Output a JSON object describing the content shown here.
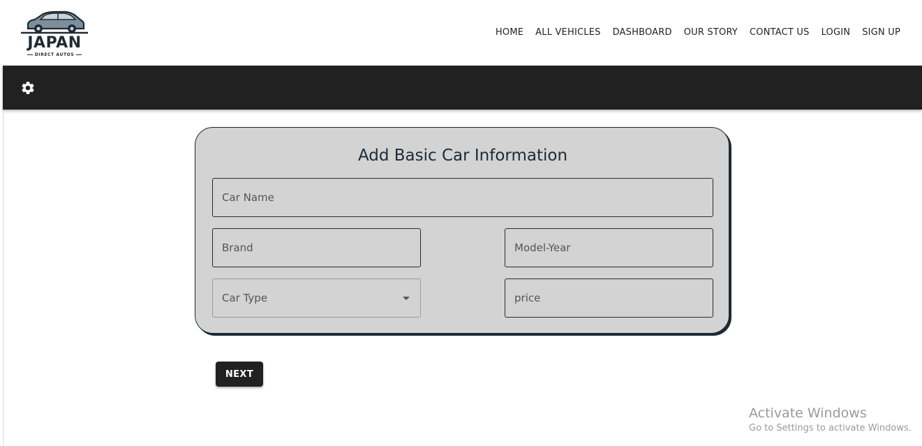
{
  "brand": {
    "name": "JAPAN",
    "tagline": "DIRECT AUTOS",
    "logo_icon": "car-icon"
  },
  "nav": {
    "items": [
      {
        "label": "HOME"
      },
      {
        "label": "ALL VEHICLES"
      },
      {
        "label": "DASHBOARD"
      },
      {
        "label": "OUR STORY"
      },
      {
        "label": "CONTACT US"
      },
      {
        "label": "LOGIN"
      },
      {
        "label": "SIGN UP"
      }
    ]
  },
  "toolbar": {
    "settings_icon": "gear-icon"
  },
  "form": {
    "title": "Add Basic Car Information",
    "car_name": {
      "placeholder": "Car Name",
      "value": ""
    },
    "brand": {
      "placeholder": "Brand",
      "value": ""
    },
    "model_year": {
      "placeholder": "Model-Year",
      "value": ""
    },
    "car_type": {
      "label": "Car Type",
      "value": ""
    },
    "price": {
      "placeholder": "price",
      "value": ""
    },
    "next_label": "NEXT"
  },
  "watermark": {
    "title": "Activate Windows",
    "subtitle": "Go to Settings to activate Windows."
  },
  "colors": {
    "toolbar_bg": "#212121",
    "card_bg": "#d3d3d3",
    "title_color": "#1e2a35",
    "button_bg": "#212121"
  }
}
